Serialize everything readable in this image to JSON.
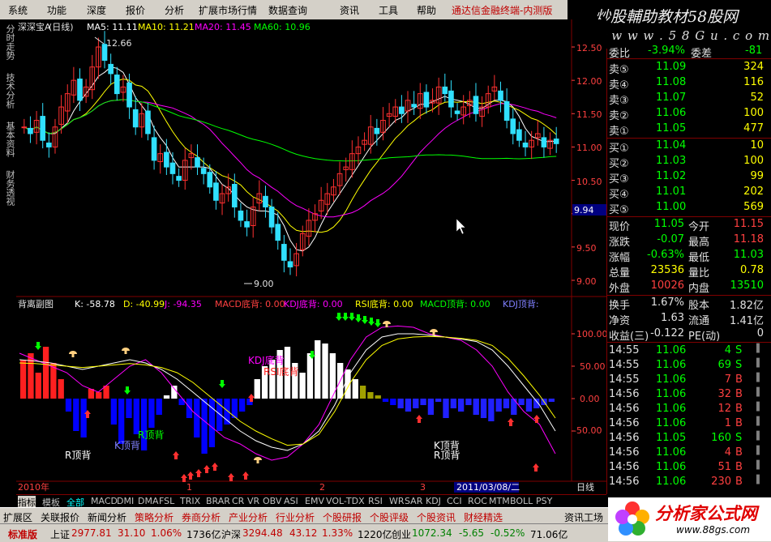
{
  "menu": [
    "系统",
    "功能",
    "深度",
    "报价",
    "分析",
    "扩展市场行情",
    "数据查询",
    "资讯",
    "工具",
    "帮助"
  ],
  "brand_title": "通达信金融终端-内测版",
  "brand_tail": "深",
  "watermark": {
    "line1": "炒股輔助教材58股网",
    "line2": "★ w w w . 5 8 G u . c o m ★"
  },
  "left_tabs": [
    "分时走势",
    "技术分析",
    "基本资料",
    "财务透视"
  ],
  "chart": {
    "stock": "深深宝A",
    "period": "(日线)",
    "ma": [
      {
        "label": "MA5: 11.11",
        "color": "#ffffff"
      },
      {
        "label": "MA10: 11.21",
        "color": "#ffff00"
      },
      {
        "label": "MA20: 11.45",
        "color": "#ff00ff"
      },
      {
        "label": "MA60: 10.96",
        "color": "#00ff00"
      }
    ],
    "high_label": "12.66",
    "low_label": "9.00",
    "price_ticks": [
      "12.50",
      "12.00",
      "11.50",
      "11.00",
      "10.50",
      "10.00",
      "9.50",
      "9.00"
    ],
    "cursor_price": "9.94",
    "sub_title": "背离副图",
    "sub_values": [
      {
        "label": "K: -58.78",
        "color": "#ffffff"
      },
      {
        "label": "D: -40.99",
        "color": "#ffff00"
      },
      {
        "label": "J: -94.35",
        "color": "#ff00ff"
      },
      {
        "label": "MACD底背: 0.00",
        "color": "#ff4040"
      },
      {
        "label": "KDJ底背: 0.00",
        "color": "#ff00ff"
      },
      {
        "label": "RSI底背: 0.00",
        "color": "#ffff00"
      },
      {
        "label": "MACD顶背: 0.00",
        "color": "#00ff00"
      },
      {
        "label": "KDJ顶背:",
        "color": "#8080ff"
      }
    ],
    "sub_ticks": [
      "100.00",
      "50.00",
      "0.00",
      "-50.00"
    ],
    "sub_annotations": {
      "kdj_bottom_1": "KDJ底背",
      "rsi_bottom_1": "RSI底背",
      "r_top_1": "R顶背",
      "k_top_1": "K顶背",
      "r_top_2": "R顶背",
      "k_top_2": "K顶背",
      "r_top_3": "R顶背"
    },
    "x_labels": [
      "2010年",
      "1",
      "2",
      "3"
    ],
    "date_highlight": "2011/03/08/二",
    "period_label": "日线"
  },
  "quote": {
    "weibi": {
      "label": "委比",
      "value": "-3.94%",
      "label2": "委差",
      "value2": "-81"
    },
    "asks": [
      {
        "label": "卖⑤",
        "price": "11.09",
        "vol": "324"
      },
      {
        "label": "卖④",
        "price": "11.08",
        "vol": "116"
      },
      {
        "label": "卖③",
        "price": "11.07",
        "vol": "52"
      },
      {
        "label": "卖②",
        "price": "11.06",
        "vol": "100"
      },
      {
        "label": "卖①",
        "price": "11.05",
        "vol": "477"
      }
    ],
    "bids": [
      {
        "label": "买①",
        "price": "11.04",
        "vol": "10"
      },
      {
        "label": "买②",
        "price": "11.03",
        "vol": "100"
      },
      {
        "label": "买③",
        "price": "11.02",
        "vol": "99"
      },
      {
        "label": "买④",
        "price": "11.01",
        "vol": "202"
      },
      {
        "label": "买⑤",
        "price": "11.00",
        "vol": "569"
      }
    ],
    "stats": [
      {
        "l1": "现价",
        "v1": "11.05",
        "l2": "今开",
        "v2": "11.15"
      },
      {
        "l1": "涨跌",
        "v1": "-0.07",
        "l2": "最高",
        "v2": "11.18"
      },
      {
        "l1": "涨幅",
        "v1": "-0.63%",
        "l2": "最低",
        "v2": "11.03"
      },
      {
        "l1": "总量",
        "v1": "23536",
        "l2": "量比",
        "v2": "0.78"
      },
      {
        "l1": "外盘",
        "v1": "10026",
        "l2": "内盘",
        "v2": "13510"
      }
    ],
    "stats2": [
      {
        "l1": "换手",
        "v1": "1.67%",
        "l2": "股本",
        "v2": "1.82亿"
      },
      {
        "l1": "净资",
        "v1": "1.63",
        "l2": "流通",
        "v2": "1.41亿"
      },
      {
        "l1": "收益(三)",
        "v1": "-0.122",
        "l2": "PE(动)",
        "v2": "0"
      }
    ],
    "ticks": [
      {
        "t": "14:55",
        "p": "11.06",
        "v": "4",
        "d": "S"
      },
      {
        "t": "14:55",
        "p": "11.06",
        "v": "69",
        "d": "S"
      },
      {
        "t": "14:55",
        "p": "11.06",
        "v": "7",
        "d": "B"
      },
      {
        "t": "14:56",
        "p": "11.06",
        "v": "32",
        "d": "B"
      },
      {
        "t": "14:56",
        "p": "11.06",
        "v": "12",
        "d": "B"
      },
      {
        "t": "14:56",
        "p": "11.06",
        "v": "1",
        "d": "B"
      },
      {
        "t": "14:56",
        "p": "11.05",
        "v": "160",
        "d": "S"
      },
      {
        "t": "14:56",
        "p": "11.06",
        "v": "4",
        "d": "B"
      },
      {
        "t": "14:56",
        "p": "11.06",
        "v": "51",
        "d": "B"
      },
      {
        "t": "14:56",
        "p": "11.06",
        "v": "230",
        "d": "B"
      }
    ]
  },
  "indicator_tabs": [
    "指标",
    "模板",
    "全部",
    "MACD",
    "DMI",
    "DMA",
    "FSL",
    "TRIX",
    "BRAR",
    "CR",
    "VR",
    "OBV",
    "ASI",
    "EMV",
    "VOL-TDX",
    "RSI",
    "WR",
    "SAR",
    "KDJ",
    "CCI",
    "ROC",
    "MTM",
    "BOLL",
    "PSY"
  ],
  "bottom_tabs": [
    "扩展区",
    "关联报价",
    "新闻分析",
    "策略分析",
    "券商分析",
    "产业分析",
    "行业分析",
    "个股研报",
    "个股评级",
    "个股资讯",
    "财经精选"
  ],
  "bottom_right": "资讯工场",
  "status": {
    "name": "标准版",
    "items": [
      {
        "label": "上证",
        "value": "2977.81",
        "chg": "31.10",
        "pct": "1.06%",
        "amt": "1736亿"
      },
      {
        "label": "沪深",
        "value": "3294.48",
        "chg": "43.12",
        "pct": "1.33%",
        "amt": "1220亿"
      },
      {
        "label": "创业",
        "value": "1072.34",
        "chg": "-5.65",
        "pct": "-0.52%",
        "amt": "71.06亿"
      }
    ]
  },
  "logo": {
    "title": "分析家公式网",
    "url": "www.88gs.com"
  }
}
